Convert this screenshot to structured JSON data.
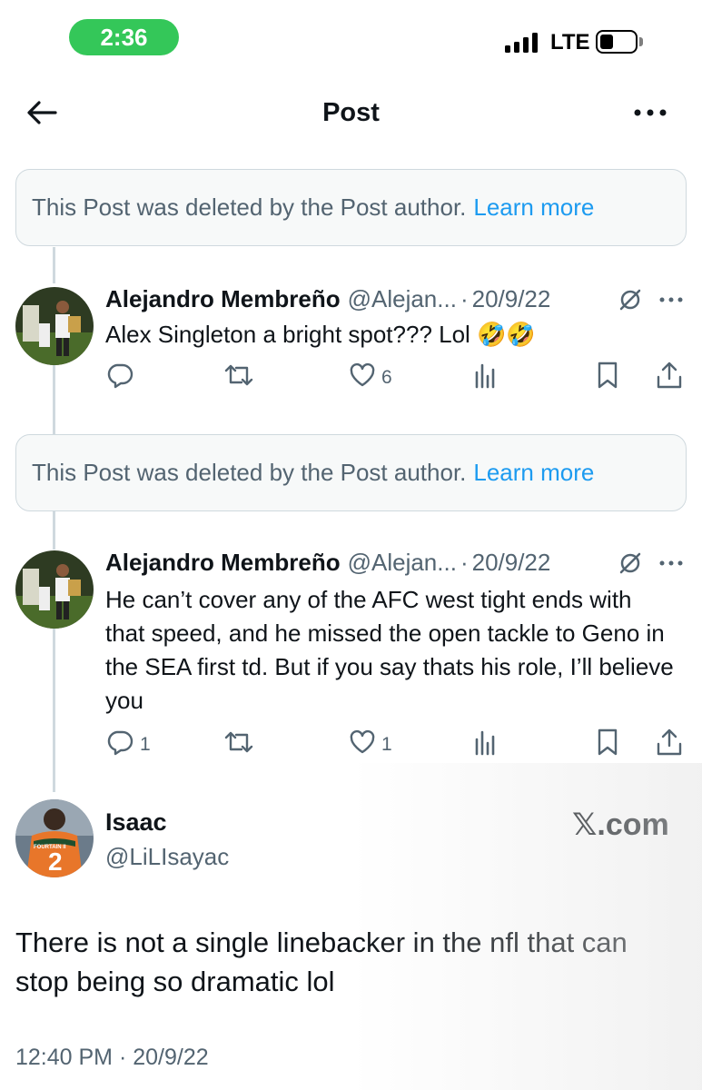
{
  "status_bar": {
    "time": "2:36",
    "network": "LTE"
  },
  "header": {
    "title": "Post"
  },
  "deleted_notice": {
    "text": "This Post was deleted by the Post author.",
    "link": "Learn more"
  },
  "tweets": [
    {
      "name": "Alejandro Membreño",
      "handle": "@Alejan...",
      "separator": "·",
      "date": "20/9/22",
      "text": "Alex Singleton a bright spot??? Lol 🤣🤣",
      "replies": "",
      "retweets": "",
      "likes": "6"
    },
    {
      "name": "Alejandro Membreño",
      "handle": "@Alejan...",
      "separator": "·",
      "date": "20/9/22",
      "text": "He can’t cover any of the AFC west tight ends with that speed, and he missed the open tackle to Geno in the SEA first td. But if you say thats his role, I’ll believe you",
      "replies": "1",
      "retweets": "",
      "likes": "1"
    }
  ],
  "main_post": {
    "name": "Isaac",
    "handle": "@LiLIsayac",
    "watermark": "𝕏.com",
    "text": "There is not a single linebacker in the nfl that can stop being so dramatic lol",
    "timestamp": "12:40 PM · 20/9/22",
    "avatar_jersey": "2",
    "avatar_jersey_name": "FOURTAIN II"
  },
  "colors": {
    "accent": "#1d9bf0",
    "muted": "#536471",
    "text": "#0f1419",
    "status_green": "#34c759"
  }
}
